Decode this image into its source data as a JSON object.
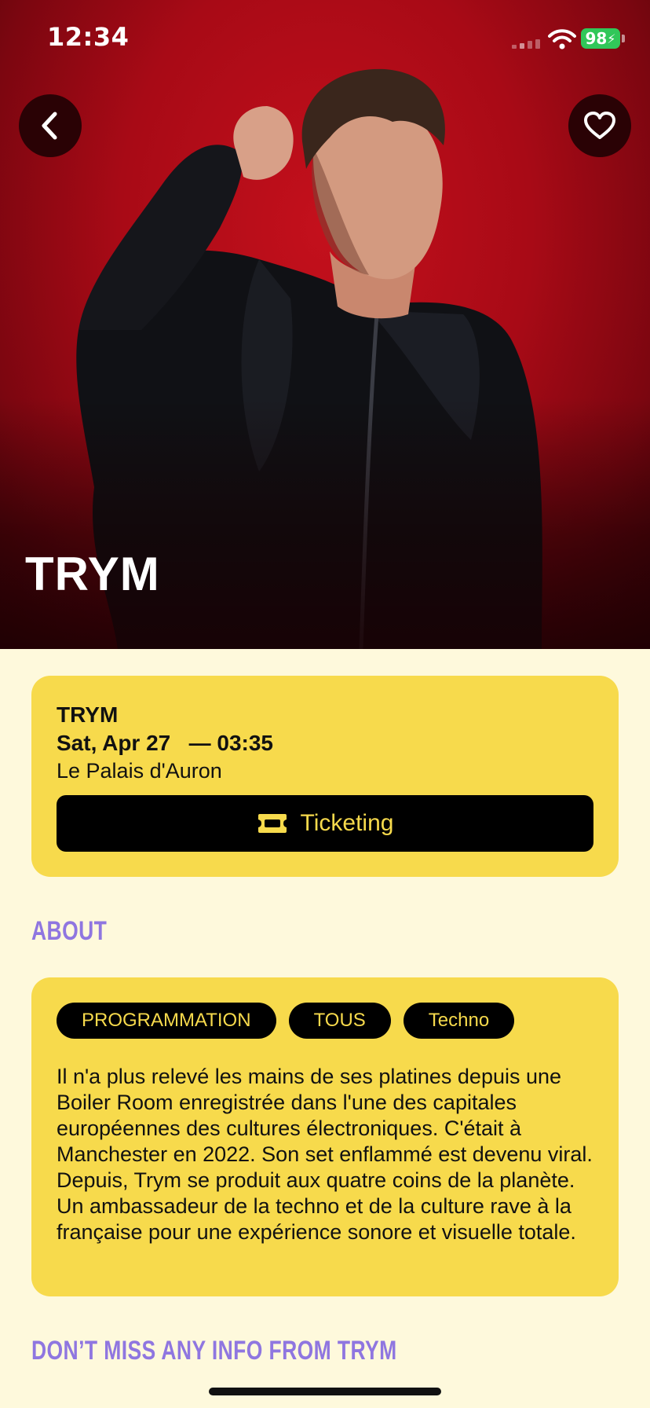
{
  "status_bar": {
    "time": "12:34",
    "battery": "98"
  },
  "hero": {
    "artist": "TRYM"
  },
  "event": {
    "name": "TRYM",
    "date": "Sat, Apr 27",
    "time": "— 03:35",
    "venue": "Le Palais d'Auron",
    "ticket_label": "Ticketing"
  },
  "about": {
    "heading": "ABOUT",
    "tags": [
      "PROGRAMMATION",
      "TOUS",
      "Techno"
    ],
    "text": "Il n'a plus relevé les mains de ses platines depuis une Boiler Room enregistrée dans l'une des capitales européennes des cultures électroniques. C'était à Manchester en 2022. Son set enflammé est devenu viral. Depuis, Trym se produit aux quatre coins de la planète. Un ambassadeur de la techno et de la culture rave à la française pour une expérience sonore et visuelle totale."
  },
  "news": {
    "heading": "DON’T MISS ANY INFO FROM TRYM"
  },
  "colors": {
    "accent_yellow": "#F7DA4C",
    "section_purple": "#8F76E0",
    "background": "#FEF9DC",
    "hero_red": "#B00C18"
  }
}
